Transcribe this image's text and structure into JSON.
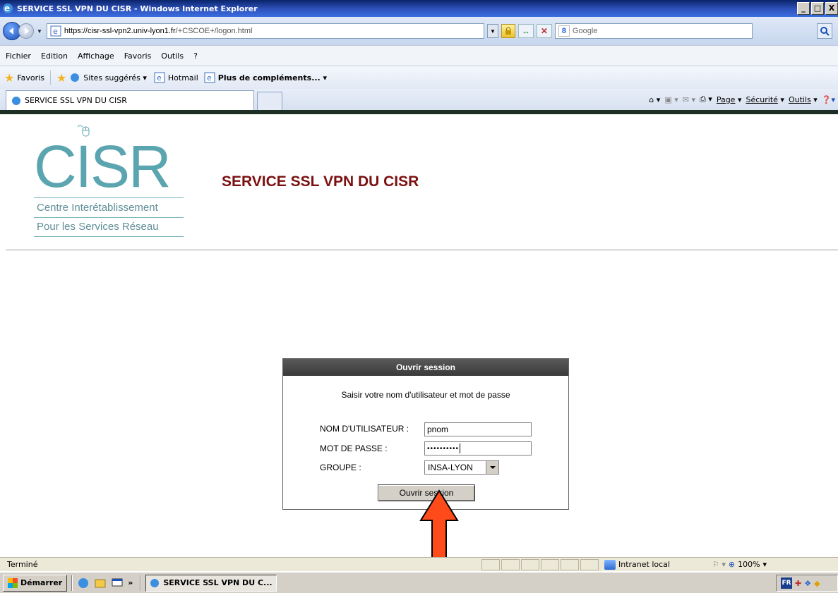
{
  "window": {
    "title": "SERVICE SSL VPN DU CISR - Windows Internet Explorer",
    "btn_min": "_",
    "btn_max": "□",
    "btn_close": "X"
  },
  "address": {
    "url_host": "https://cisr-ssl-vpn2.univ-lyon1.fr",
    "url_path": "/+CSCOE+/logon.html",
    "search_placeholder": "Google"
  },
  "menu": [
    "Fichier",
    "Edition",
    "Affichage",
    "Favoris",
    "Outils",
    "?"
  ],
  "favorites_bar": {
    "favoris": "Favoris",
    "sites": "Sites suggérés ▾",
    "hotmail": "Hotmail",
    "more": "Plus de compléments... ▾"
  },
  "tab": {
    "title": "SERVICE SSL VPN DU CISR"
  },
  "command_bar": {
    "page": "Page",
    "securite": "Sécurité",
    "outils": "Outils"
  },
  "logo": {
    "big": "CISR",
    "line1": "Centre Interétablissement",
    "line2": "Pour les Services Réseau"
  },
  "page_title": "SERVICE SSL VPN DU CISR",
  "login": {
    "header": "Ouvrir session",
    "prompt": "Saisir votre nom d'utilisateur et mot de passe",
    "user_label": "NOM D'UTILISATEUR :",
    "user_value": "pnom",
    "pass_label": "MOT DE PASSE :",
    "pass_value": "••••••••••",
    "group_label": "GROUPE :",
    "group_value": "INSA-LYON",
    "submit": "Ouvrir session"
  },
  "annotation": {
    "arrow_color": "#ff4a1a"
  },
  "statusbar": {
    "text": "Terminé",
    "zone": "Intranet local",
    "zoom": "100%"
  },
  "taskbar": {
    "start": "Démarrer",
    "chevron": "»",
    "task": "SERVICE SSL VPN DU C...",
    "lang": "FR"
  },
  "colors": {
    "title_red": "#7b1010",
    "logo_teal": "#5aa5b0",
    "header_dark": "#4a4a4a"
  }
}
